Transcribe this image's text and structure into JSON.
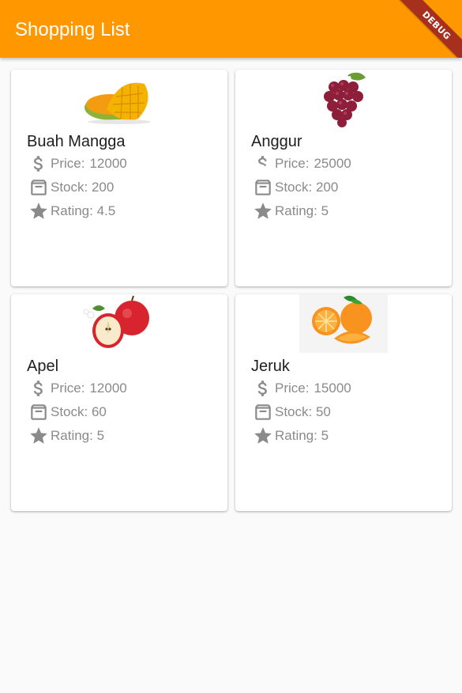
{
  "appbar": {
    "title": "Shopping List",
    "color": "#ff9800",
    "debug_banner": "DEBUG"
  },
  "products": [
    {
      "name": "Buah Mangga",
      "image_icon": "mango-image",
      "price_label": "Price:",
      "price": "12000",
      "stock": "Stock: 200",
      "rating": "Rating: 4.5"
    },
    {
      "name": "Anggur",
      "image_icon": "grapes-image",
      "price_label": "Price:",
      "price": "25000",
      "stock": "Stock: 200",
      "rating": "Rating: 5"
    },
    {
      "name": "Apel",
      "image_icon": "apple-image",
      "price_label": "Price:",
      "price": "12000",
      "stock": "Stock: 60",
      "rating": "Rating: 5"
    },
    {
      "name": "Jeruk",
      "image_icon": "orange-image",
      "price_label": "Price:",
      "price": "15000",
      "stock": "Stock: 50",
      "rating": "Rating: 5"
    }
  ],
  "icons": {
    "price": "dollar-icon",
    "stock": "archive-box-icon",
    "rating": "star-icon"
  },
  "colors": {
    "background": "#fafafa",
    "card": "#ffffff",
    "meta_text": "#8a8a8a"
  }
}
